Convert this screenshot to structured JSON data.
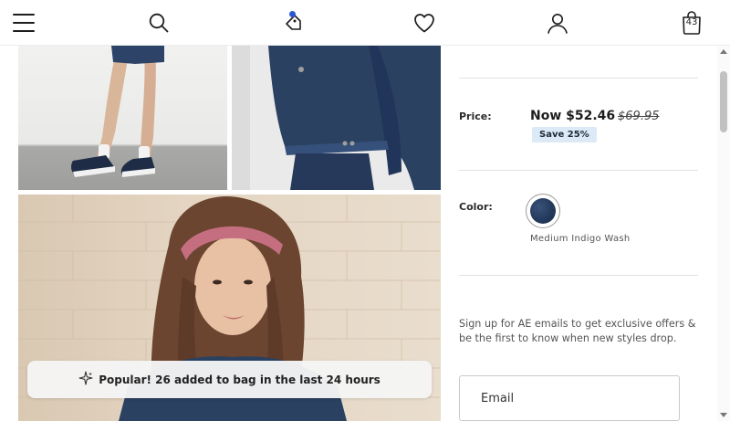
{
  "header": {
    "icons": [
      "menu-icon",
      "search-icon",
      "deals-tag-icon",
      "favorites-heart-icon",
      "account-icon",
      "shopping-bag-icon"
    ],
    "bag_count": "43",
    "notification_color": "#2a57d6"
  },
  "gallery": {
    "toast_text": "Popular! 26 added to bag in the last 24 hours",
    "toast_icon": "sparkle-icon"
  },
  "product": {
    "price_label": "Price:",
    "price_now": "Now $52.46",
    "price_was": "$69.95",
    "save_badge": "Save 25%",
    "color_label": "Color:",
    "color_name": "Medium Indigo Wash",
    "swatch_color": "#243a5d"
  },
  "signup": {
    "text": "Sign up for AE emails to get exclusive offers & be the first to know when new styles drop.",
    "email_placeholder": "Email"
  },
  "colors": {
    "badge_bg": "#dbeaf6"
  }
}
